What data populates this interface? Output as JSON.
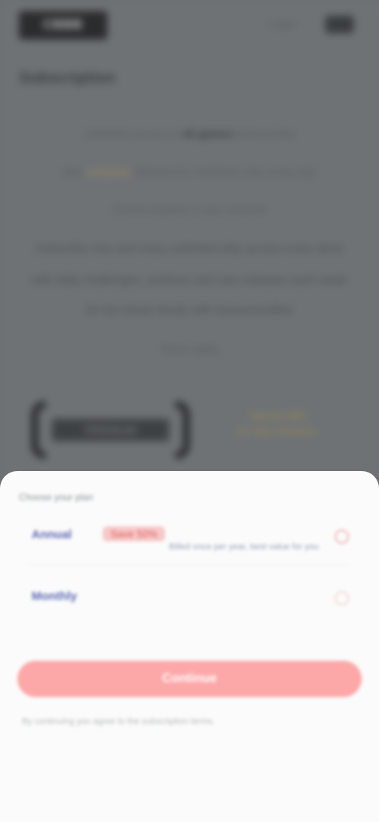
{
  "header": {
    "logo_text": "CBBB",
    "right_text": "Login"
  },
  "background": {
    "heading": "Subscription",
    "lines": [
      {
        "pre": "Unlimited access to ",
        "bold": "all games",
        "post": " and puzzles"
      },
      {
        "pre": "plus ",
        "accent": "exclusive",
        "post": " features for members only, every day"
      },
      {
        "pre": "",
        "bold": "",
        "post": "Cancel anytime in your account"
      },
      {
        "pre": "Subscribe now and enjoy unlimited play across every device",
        "bold": "",
        "post": ""
      },
      {
        "pre": "with daily challenges, archives and new releases each week",
        "bold": "",
        "post": ""
      },
      {
        "pre": "for the whole family with shared profiles",
        "bold": "",
        "post": ""
      },
      {
        "pre": "Terms apply",
        "bold": "",
        "post": ""
      }
    ],
    "brand": "PREMIUM",
    "promo_line1": "Special offer",
    "promo_line2": "for new members"
  },
  "sheet": {
    "title": "Choose your plan",
    "options": [
      {
        "name": "Annual",
        "badge": "Save 50%",
        "desc": "Billed once per year, best value for you",
        "selected": true
      },
      {
        "name": "Monthly",
        "badge": "",
        "desc": "",
        "selected": false
      }
    ],
    "button_label": "Continue",
    "terms": "By continuing you agree to the subscription terms."
  },
  "colors": {
    "accent": "#fca8a8",
    "option_name": "#5a67b3",
    "badge_bg": "#f6c8c8",
    "overlay": "#6e7275"
  }
}
